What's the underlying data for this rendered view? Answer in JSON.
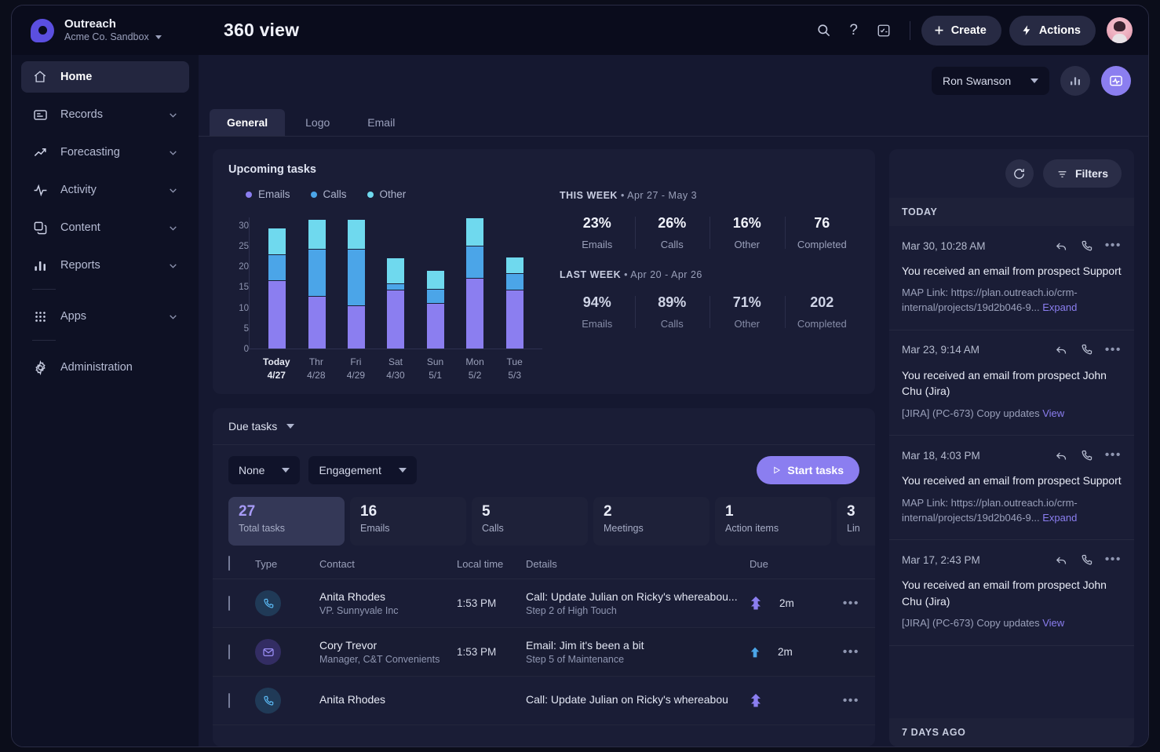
{
  "brand": {
    "name": "Outreach",
    "workspace": "Acme Co. Sandbox"
  },
  "header": {
    "title": "360 view",
    "search_icon": "search-icon",
    "help_icon": "question-mark-icon",
    "tasks_icon": "checklist-icon",
    "create_label": "Create",
    "actions_label": "Actions"
  },
  "sidebar": {
    "items": [
      {
        "label": "Home",
        "icon": "home-icon",
        "active": true,
        "expandable": false
      },
      {
        "label": "Records",
        "icon": "records-icon",
        "active": false,
        "expandable": true
      },
      {
        "label": "Forecasting",
        "icon": "trend-up-icon",
        "active": false,
        "expandable": true
      },
      {
        "label": "Activity",
        "icon": "pulse-icon",
        "active": false,
        "expandable": true
      },
      {
        "label": "Content",
        "icon": "copy-icon",
        "active": false,
        "expandable": true
      },
      {
        "label": "Reports",
        "icon": "bar-chart-icon",
        "active": false,
        "expandable": true
      },
      {
        "label": "Apps",
        "icon": "grid-dots-icon",
        "active": false,
        "expandable": true
      },
      {
        "label": "Administration",
        "icon": "gear-icon",
        "active": false,
        "expandable": false
      }
    ]
  },
  "subheader": {
    "user_select": "Ron Swanson",
    "chart_toggle_icon": "bar-chart-icon",
    "activity_toggle_icon": "activity-monitor-icon"
  },
  "tabs": [
    {
      "label": "General",
      "active": true
    },
    {
      "label": "Logo",
      "active": false
    },
    {
      "label": "Email",
      "active": false
    }
  ],
  "upcoming": {
    "title": "Upcoming tasks",
    "this_week": {
      "prefix": "THIS WEEK",
      "range": "Apr 27 - May 3"
    },
    "last_week": {
      "prefix": "LAST WEEK",
      "range": "Apr 20 - Apr 26"
    },
    "this_week_stats": [
      {
        "value": "23%",
        "label": "Emails"
      },
      {
        "value": "26%",
        "label": "Calls"
      },
      {
        "value": "16%",
        "label": "Other"
      },
      {
        "value": "76",
        "label": "Completed"
      }
    ],
    "last_week_stats": [
      {
        "value": "94%",
        "label": "Emails"
      },
      {
        "value": "89%",
        "label": "Calls"
      },
      {
        "value": "71%",
        "label": "Other"
      },
      {
        "value": "202",
        "label": "Completed"
      }
    ]
  },
  "chart_data": {
    "type": "bar",
    "title": "Upcoming tasks",
    "stacked": true,
    "xlabel": "",
    "ylabel": "",
    "ylim": [
      0,
      32
    ],
    "yticks": [
      0,
      5,
      10,
      15,
      20,
      25,
      30
    ],
    "grid": false,
    "legend_position": "top-left",
    "categories": [
      "Today 4/27",
      "Thr 4/28",
      "Fri 4/29",
      "Sat 4/30",
      "Sun 5/1",
      "Mon 5/2",
      "Tue 5/3"
    ],
    "category_labels": [
      {
        "day": "Today",
        "date": "4/27",
        "current": true
      },
      {
        "day": "Thr",
        "date": "4/28",
        "current": false
      },
      {
        "day": "Fri",
        "date": "4/29",
        "current": false
      },
      {
        "day": "Sat",
        "date": "4/30",
        "current": false
      },
      {
        "day": "Sun",
        "date": "5/1",
        "current": false
      },
      {
        "day": "Mon",
        "date": "5/2",
        "current": false
      },
      {
        "day": "Tue",
        "date": "5/3",
        "current": false
      }
    ],
    "series": [
      {
        "name": "Emails",
        "color": "#8b7ef0",
        "values": [
          16.5,
          12.7,
          10.4,
          14.2,
          11.1,
          17.2,
          14.2
        ]
      },
      {
        "name": "Calls",
        "color": "#4ba5e8",
        "values": [
          6.3,
          11.5,
          13.8,
          1.7,
          3.3,
          7.8,
          4.0
        ]
      },
      {
        "name": "Other",
        "color": "#6fd9ee",
        "values": [
          6.5,
          7.3,
          7.2,
          6.2,
          4.6,
          6.8,
          4.0
        ]
      }
    ]
  },
  "due": {
    "title": "Due tasks",
    "filter_a": "None",
    "filter_b": "Engagement",
    "start_label": "Start tasks",
    "tiles": [
      {
        "value": "27",
        "label": "Total tasks",
        "selected": true
      },
      {
        "value": "16",
        "label": "Emails",
        "selected": false
      },
      {
        "value": "5",
        "label": "Calls",
        "selected": false
      },
      {
        "value": "2",
        "label": "Meetings",
        "selected": false
      },
      {
        "value": "1",
        "label": "Action items",
        "selected": false
      },
      {
        "value": "3",
        "label": "Lin",
        "selected": false
      }
    ],
    "columns": {
      "type": "Type",
      "contact": "Contact",
      "local_time": "Local time",
      "details": "Details",
      "due": "Due"
    },
    "rows": [
      {
        "icon": "phone-icon",
        "name": "Anita Rhodes",
        "role": "VP. Sunnyvale Inc",
        "time": "1:53 PM",
        "details": "Call: Update Julian on Ricky's whereabou...",
        "step": "Step 2 of High Touch",
        "priority": "high",
        "due": "2m"
      },
      {
        "icon": "mail-icon",
        "name": "Cory Trevor",
        "role": "Manager, C&T Convenients",
        "time": "1:53 PM",
        "details": "Email: Jim it's been a bit",
        "step": "Step 5 of Maintenance",
        "priority": "normal",
        "due": "2m"
      },
      {
        "icon": "phone-icon",
        "name": "Anita Rhodes",
        "role": "",
        "time": "",
        "details": "Call: Update Julian on Ricky's whereabou",
        "step": "",
        "priority": "high",
        "due": ""
      }
    ]
  },
  "activity": {
    "refresh_icon": "refresh-icon",
    "filters_label": "Filters",
    "section_today": "TODAY",
    "section_7days": "7 DAYS AGO",
    "items": [
      {
        "date": "Mar 30, 10:28 AM",
        "title": "You received an email from prospect Support",
        "body": "MAP Link: https://plan.outreach.io/crm-internal/projects/19d2b046-9...",
        "link": "Expand"
      },
      {
        "date": "Mar 23, 9:14 AM",
        "title": "You received an email from prospect John Chu (Jira)",
        "body": "[JIRA] (PC-673) Copy updates",
        "link": "View"
      },
      {
        "date": "Mar 18, 4:03 PM",
        "title": "You received an email from prospect Support",
        "body": "MAP Link: https://plan.outreach.io/crm-internal/projects/19d2b046-9...",
        "link": "Expand"
      },
      {
        "date": "Mar 17, 2:43 PM",
        "title": "You received an email from prospect John Chu (Jira)",
        "body": "[JIRA] (PC-673) Copy updates",
        "link": "View"
      }
    ]
  },
  "colors": {
    "accent": "#8b7ef0",
    "emails": "#8b7ef0",
    "calls": "#4ba5e8",
    "other": "#6fd9ee",
    "panel": "#1a1d36",
    "background": "#151830"
  }
}
